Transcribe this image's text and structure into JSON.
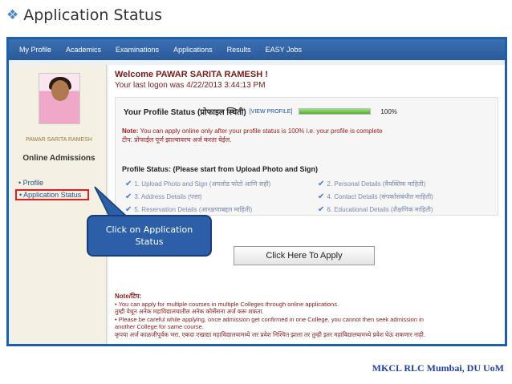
{
  "slide": {
    "title": "Application Status",
    "footer": "MKCL RLC Mumbai, DU UoM"
  },
  "topnav": [
    "My Profile",
    "Academics",
    "Examinations",
    "Applications",
    "Results",
    "EASY Jobs"
  ],
  "sidebar": {
    "user_name": "PAWAR SARITA RAMESH",
    "section": "Online Admissions",
    "links": [
      "Profile",
      "Application Status"
    ]
  },
  "main": {
    "welcome": "Welcome PAWAR SARITA RAMESH !",
    "last_logon": "Your last logon was 4/22/2013 3:44:13 PM",
    "profile_status_label": "Your Profile Status (प्रोफाइल स्थिती)",
    "view_profile": "[VIEW PROFILE]",
    "profile_percent": "100%",
    "profile_progress": 1.0,
    "note_label": "Note:",
    "note_en": "You can apply online only after your profile status is 100% i.e. your profile is complete",
    "note_mr": "टीप: प्रोफाईल पूर्ण झाल्यावरच अर्ज करता येईल.",
    "steps_heading": "Profile Status: (Please start from Upload Photo and Sign)",
    "steps": [
      "1. Upload Photo and Sign (अपलोड फोटो आणि सही)",
      "2. Personal Details (वैयक्तिक माहिती)",
      "3. Address Details (पत्ता)",
      "4. Contact Details (संपर्कासंबंधीत माहिती)",
      "5. Reservation Details (आरक्षणाबद्दल माहिती)",
      "6. Educational Details (शैक्षणिक माहिती)"
    ],
    "apply_button": "Click Here To Apply",
    "bottom_note_label": "Note/टिप:",
    "bottom_note_lines": [
      "• You can apply for multiple courses in multiple Colleges through online applications.",
      "तुम्ही येथून अनेक महाविद्यालयातील अनेक कोर्सेसना अर्ज करू शकता.",
      "• Please be careful while applying, once admission get confirmed in one College, you cannot then seek admission in",
      "another College for same course.",
      "कृपया अर्ज काळजीपूर्वक भरा, एकदा एखाद्या महाविद्यालयामध्ये जर प्रवेश निश्चित झाला तर तुम्ही इतर महाविद्यालयामध्ये प्रवेश घेऊ शकणार नाही."
    ]
  },
  "callout": {
    "text": "Click on Application Status"
  },
  "colors": {
    "nav_blue": "#2a5a9b",
    "frame_border": "#1f5fa8",
    "highlight_red": "#e02020",
    "heading_maroon": "#7a1a1a",
    "progress_green": "#4caf32",
    "callout_blue": "#2d5fa8",
    "footer_blue": "#1f3fa8"
  }
}
